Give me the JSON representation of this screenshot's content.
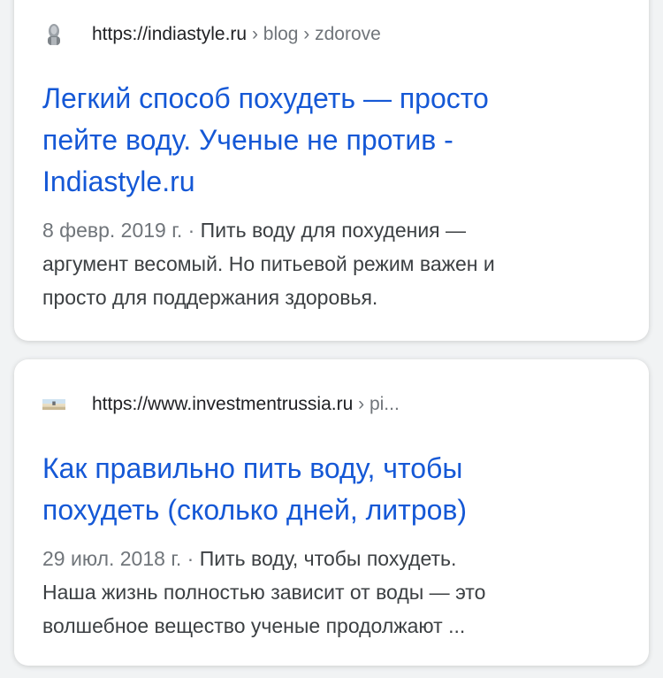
{
  "results": [
    {
      "favicon": "buddha-statue-icon",
      "url": "https://indiastyle.ru",
      "breadcrumb": "› blog › zdorove",
      "title_lines": [
        "Легкий способ похудеть — просто",
        "пейте воду. Ученые не против -",
        "Indiastyle.ru"
      ],
      "date": "8 февр. 2019 г.",
      "separator": " · ",
      "snippet_lines": [
        "Пить воду для похудения —",
        "аргумент весомый. Но питьевой режим важен и",
        "просто для поддержания здоровья."
      ]
    },
    {
      "favicon": "landscape-icon",
      "url": "https://www.investmentrussia.ru",
      "breadcrumb": "› pi...",
      "title_lines": [
        "Как правильно пить воду, чтобы",
        "похудеть (сколько дней, литров)"
      ],
      "date": "29 июл. 2018 г.",
      "separator": " · ",
      "snippet_lines": [
        "Пить воду, чтобы похудеть.",
        "Наша жизнь полностью зависит от воды — это",
        "волшебное вещество ученые продолжают ..."
      ]
    }
  ],
  "colors": {
    "title_link": "#1558d6",
    "url_text": "#202124",
    "meta_text": "#70757a",
    "snippet_text": "#3c4043",
    "background": "#f1f3f4"
  }
}
